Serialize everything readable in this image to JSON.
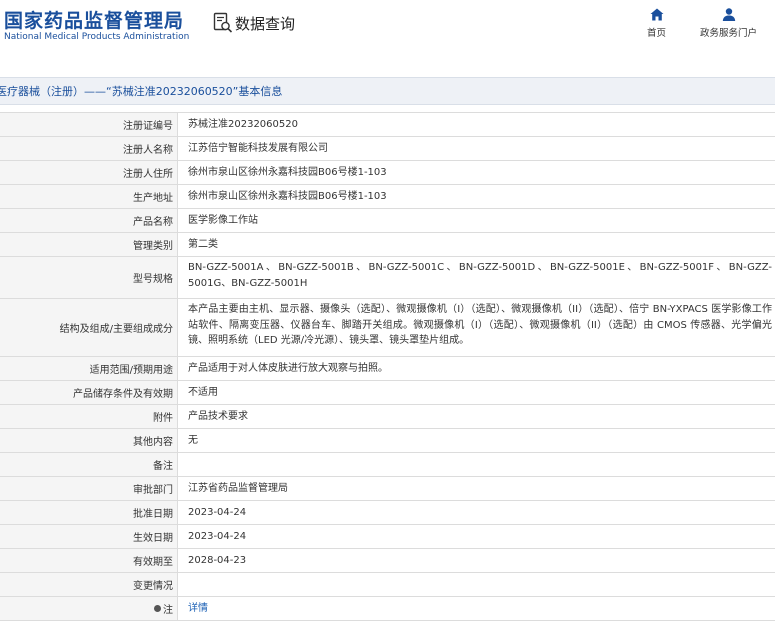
{
  "header": {
    "logo_cn": "国家药品监督管理局",
    "logo_en": "National Medical Products Administration",
    "query_label": "数据查询",
    "nav": [
      {
        "label": "首页",
        "icon": "home-icon"
      },
      {
        "label": "政务服务门户",
        "icon": "user-icon"
      }
    ],
    "accent_color": "#1a4f9c"
  },
  "title": "医疗器械（注册）——“苏械注准20232060520”基本信息",
  "rows": [
    {
      "label": "注册证编号",
      "value": "苏械注准20232060520"
    },
    {
      "label": "注册人名称",
      "value": "江苏倍宁智能科技发展有限公司"
    },
    {
      "label": "注册人住所",
      "value": "徐州市泉山区徐州永嘉科技园B06号楼1-103"
    },
    {
      "label": "生产地址",
      "value": "徐州市泉山区徐州永嘉科技园B06号楼1-103"
    },
    {
      "label": "产品名称",
      "value": "医学影像工作站"
    },
    {
      "label": "管理类别",
      "value": "第二类"
    },
    {
      "label": "型号规格",
      "value": "BN-GZZ-5001A、BN-GZZ-5001B、BN-GZZ-5001C、BN-GZZ-5001D、BN-GZZ-5001E、BN-GZZ-5001F、BN-GZZ-5001G、BN-GZZ-5001H"
    },
    {
      "label": "结构及组成/主要组成成分",
      "value": "本产品主要由主机、显示器、摄像头（选配）、微观摄像机（I）（选配）、微观摄像机（II）（选配）、倍宁 BN-YXPACS 医学影像工作站软件、隔离变压器、仪器台车、脚踏开关组成。微观摄像机（I）（选配）、微观摄像机（II）（选配）由 CMOS 传感器、光学偏光镜、照明系统（LED 光源/冷光源）、镜头罩、镜头罩垫片组成。"
    },
    {
      "label": "适用范围/预期用途",
      "value": "产品适用于对人体皮肤进行放大观察与拍照。"
    },
    {
      "label": "产品储存条件及有效期",
      "value": "不适用"
    },
    {
      "label": "附件",
      "value": "产品技术要求"
    },
    {
      "label": "其他内容",
      "value": "无"
    },
    {
      "label": "备注",
      "value": ""
    },
    {
      "label": "审批部门",
      "value": "江苏省药品监督管理局"
    },
    {
      "label": "批准日期",
      "value": "2023-04-24"
    },
    {
      "label": "生效日期",
      "value": "2023-04-24"
    },
    {
      "label": "有效期至",
      "value": "2028-04-23"
    },
    {
      "label": "变更情况",
      "value": ""
    },
    {
      "label": "注",
      "value": "详情"
    }
  ]
}
